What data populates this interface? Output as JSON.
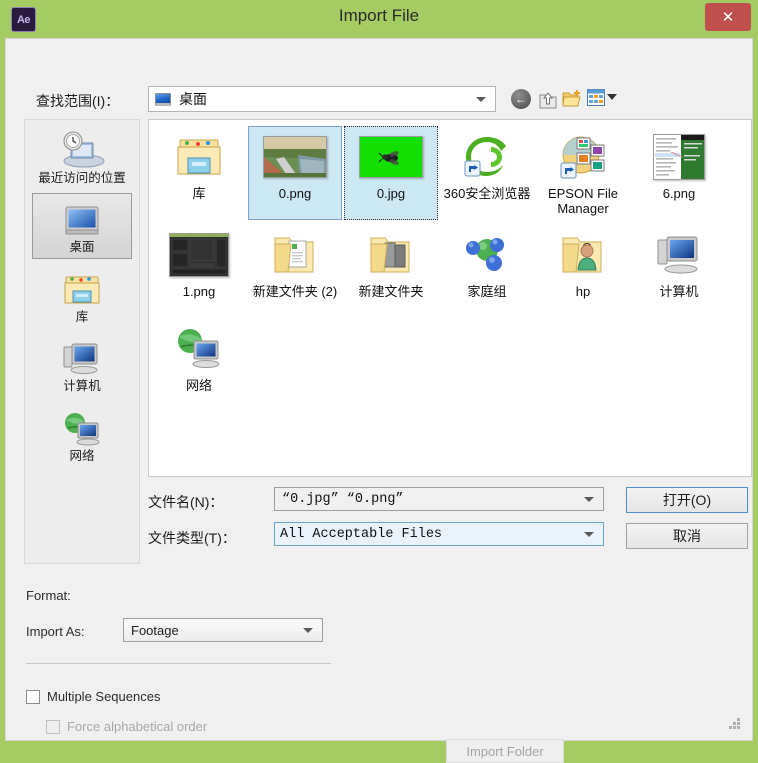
{
  "window": {
    "title": "Import File",
    "app_icon": "after-effects-icon",
    "app_icon_text": "Ae",
    "close_label": "✕",
    "accent_color": "#a5cc62",
    "close_color": "#c0504d"
  },
  "path_bar": {
    "label": "查找范围(I)：",
    "value": "桌面",
    "icon": "desktop-icon",
    "toolbar": [
      {
        "name": "back-icon",
        "label": "后退"
      },
      {
        "name": "up-folder-icon",
        "label": "向上一级"
      },
      {
        "name": "new-folder-icon",
        "label": "新建文件夹"
      },
      {
        "name": "views-icon",
        "label": "视图"
      }
    ]
  },
  "places": {
    "items": [
      {
        "label": "最近访问的位置",
        "icon": "recent-places-icon",
        "selected": false
      },
      {
        "label": "桌面",
        "icon": "desktop-icon",
        "selected": true
      },
      {
        "label": "库",
        "icon": "library-icon",
        "selected": false
      },
      {
        "label": "计算机",
        "icon": "computer-icon",
        "selected": false
      },
      {
        "label": "网络",
        "icon": "network-icon",
        "selected": false
      }
    ]
  },
  "file_list": {
    "items": [
      {
        "label": "库",
        "icon": "library-folder-icon",
        "selected": false,
        "focused": false
      },
      {
        "label": "0.png",
        "icon": "image-thumbnail-road",
        "selected": true,
        "focused": false
      },
      {
        "label": "0.jpg",
        "icon": "image-thumbnail-fly-green",
        "selected": true,
        "focused": true
      },
      {
        "label": "360安全浏览器",
        "icon": "360-browser-shortcut-icon",
        "selected": false,
        "focused": false
      },
      {
        "label": "EPSON File Manager",
        "icon": "epson-file-manager-shortcut-icon",
        "selected": false,
        "focused": false
      },
      {
        "label": "6.png",
        "icon": "image-thumbnail-screenshot-green",
        "selected": false,
        "focused": false
      },
      {
        "label": "1.png",
        "icon": "image-thumbnail-dark-ui",
        "selected": false,
        "focused": false
      },
      {
        "label": "新建文件夹 (2)",
        "icon": "folder-documents-icon",
        "selected": false,
        "focused": false
      },
      {
        "label": "新建文件夹",
        "icon": "folder-pictures-icon",
        "selected": false,
        "focused": false
      },
      {
        "label": "家庭组",
        "icon": "homegroup-icon",
        "selected": false,
        "focused": false
      },
      {
        "label": "hp",
        "icon": "folder-user-icon",
        "selected": false,
        "focused": false
      },
      {
        "label": "计算机",
        "icon": "computer-icon",
        "selected": false,
        "focused": false
      },
      {
        "label": "网络",
        "icon": "network-icon",
        "selected": false,
        "focused": false
      }
    ]
  },
  "filename_row": {
    "label": "文件名(N)：",
    "value": "“0.jpg” “0.png”",
    "placeholder": ""
  },
  "filetype_row": {
    "label": "文件类型(T)：",
    "value": "All Acceptable Files"
  },
  "buttons": {
    "open": "打开(O)",
    "cancel": "取消",
    "import_folder": "Import Folder"
  },
  "options": {
    "format_label": "Format:",
    "format_value": "",
    "import_as_label": "Import As:",
    "import_as_value": "Footage",
    "multiple_sequences_label": "Multiple Sequences",
    "multiple_sequences_checked": false,
    "force_alphabetical_label": "Force alphabetical order",
    "force_alphabetical_checked": false,
    "force_alphabetical_disabled": true
  }
}
